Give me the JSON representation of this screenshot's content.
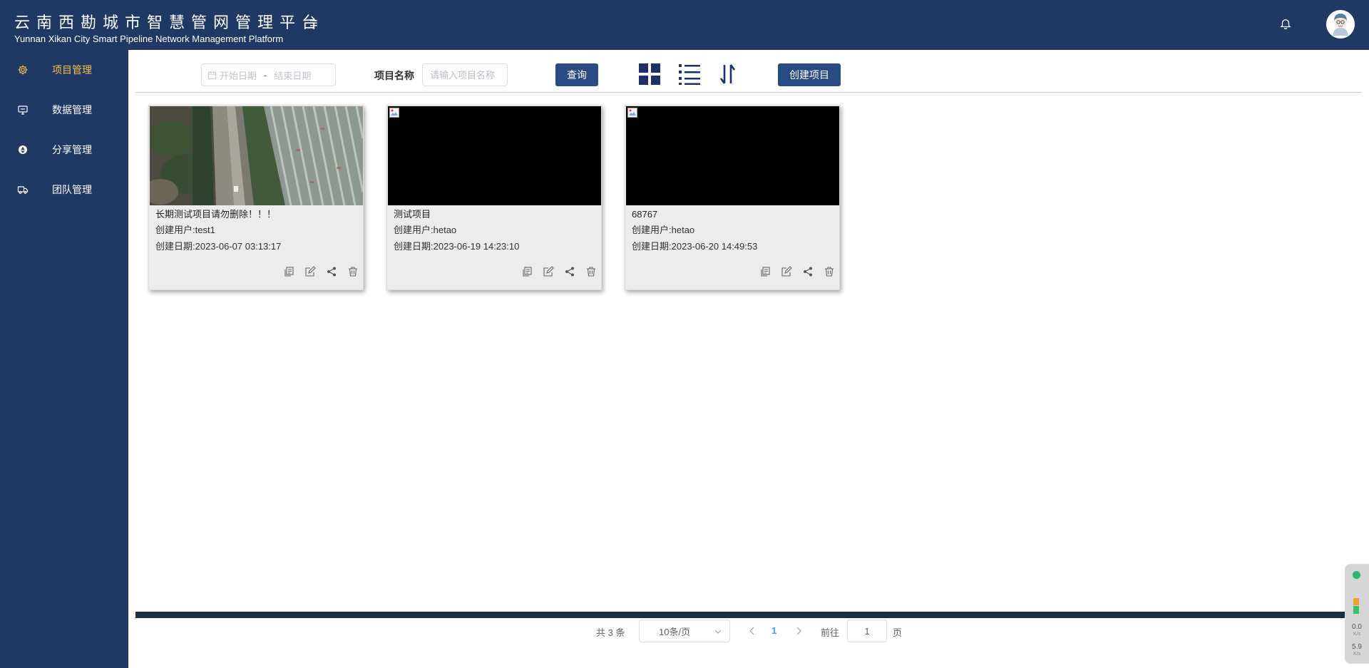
{
  "header": {
    "title_cn": "云南西勘城市智慧管网管理平台",
    "title_en": "Yunnan Xikan City Smart Pipeline Network Management Platform",
    "menu_toggle": "≡"
  },
  "sidebar": {
    "items": [
      {
        "label": "项目管理",
        "icon": "gear-icon",
        "active": true
      },
      {
        "label": "数据管理",
        "icon": "monitor-icon",
        "active": false
      },
      {
        "label": "分享管理",
        "icon": "aperture-icon",
        "active": false
      },
      {
        "label": "团队管理",
        "icon": "truck-icon",
        "active": false
      }
    ],
    "active_color": "#f5c14a"
  },
  "toolbar": {
    "start_placeholder": "开始日期",
    "range_separator": "-",
    "end_placeholder": "结束日期",
    "name_label": "项目名称",
    "name_placeholder": "请输入项目名称",
    "name_value": "",
    "query_label": "查询",
    "create_label": "创建项目",
    "view_icons": [
      "grid-view-icon",
      "list-view-icon",
      "sort-icon"
    ]
  },
  "projects": [
    {
      "title": "长期测试项目请勿删除！！！",
      "user_label": "创建用户:",
      "user": "test1",
      "date_label": "创建日期:",
      "date": "2023-06-07 03:13:17",
      "thumbnail": "aerial-image"
    },
    {
      "title": "测试项目",
      "user_label": "创建用户:",
      "user": "hetao",
      "date_label": "创建日期:",
      "date": "2023-06-19 14:23:10",
      "thumbnail": "broken-image"
    },
    {
      "title": "68767",
      "user_label": "创建用户:",
      "user": "hetao",
      "date_label": "创建日期:",
      "date": "2023-06-20 14:49:53",
      "thumbnail": "broken-image"
    }
  ],
  "card_actions": [
    "copy-icon",
    "edit-icon",
    "share-icon",
    "delete-icon"
  ],
  "pagination": {
    "total": "共 3 条",
    "page_size": "10条/页",
    "current_page": "1",
    "goto_label": "前往",
    "goto_value": "1",
    "goto_unit": "页"
  },
  "speed_widget": {
    "upload": "0.0",
    "upload_unit": "K/s",
    "download": "5.9",
    "download_unit": "K/s"
  },
  "colors": {
    "nav_bg": "#1f3864",
    "button_bg": "#2a4a82",
    "active_page": "#409eff"
  }
}
